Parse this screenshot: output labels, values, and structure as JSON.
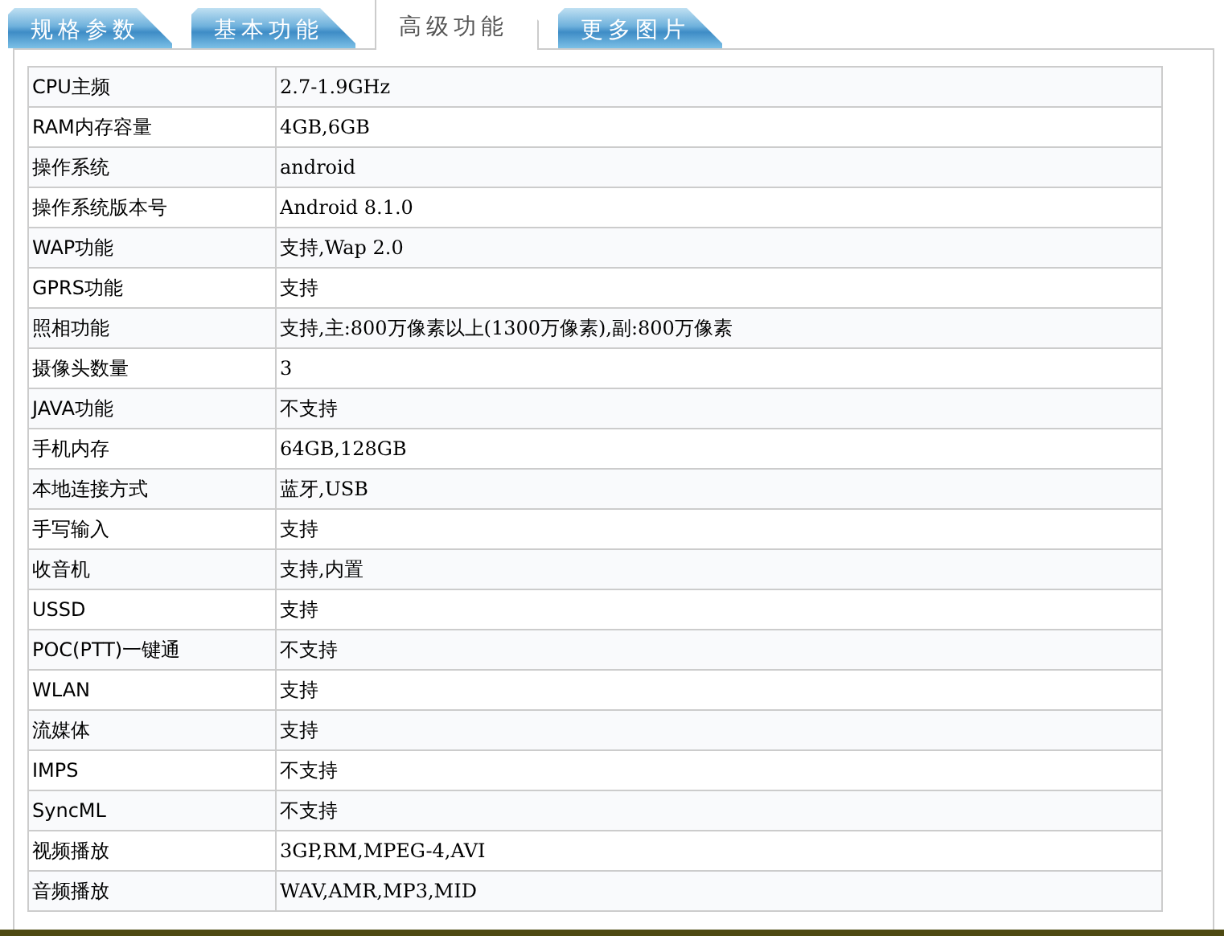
{
  "tabs": [
    {
      "label": "规格参数",
      "selected": false
    },
    {
      "label": "基本功能",
      "selected": false
    },
    {
      "label": "高级功能",
      "selected": true
    },
    {
      "label": "更多图片",
      "selected": false
    }
  ],
  "specs": [
    {
      "label": "CPU主频",
      "value": "2.7-1.9GHz"
    },
    {
      "label": "RAM内存容量",
      "value": "4GB,6GB"
    },
    {
      "label": "操作系统",
      "value": "android"
    },
    {
      "label": "操作系统版本号",
      "value": "Android 8.1.0"
    },
    {
      "label": "WAP功能",
      "value": "支持,Wap 2.0"
    },
    {
      "label": "GPRS功能",
      "value": "支持"
    },
    {
      "label": "照相功能",
      "value": "支持,主:800万像素以上(1300万像素),副:800万像素"
    },
    {
      "label": "摄像头数量",
      "value": "3"
    },
    {
      "label": "JAVA功能",
      "value": "不支持"
    },
    {
      "label": "手机内存",
      "value": "64GB,128GB"
    },
    {
      "label": "本地连接方式",
      "value": "蓝牙,USB"
    },
    {
      "label": "手写输入",
      "value": "支持"
    },
    {
      "label": "收音机",
      "value": "支持,内置"
    },
    {
      "label": "USSD",
      "value": "支持"
    },
    {
      "label": "POC(PTT)一键通",
      "value": "不支持"
    },
    {
      "label": "WLAN",
      "value": "支持"
    },
    {
      "label": "流媒体",
      "value": "支持"
    },
    {
      "label": "IMPS",
      "value": "不支持"
    },
    {
      "label": "SyncML",
      "value": "不支持"
    },
    {
      "label": "视频播放",
      "value": "3GP,RM,MPEG-4,AVI"
    },
    {
      "label": "音频播放",
      "value": "WAV,AMR,MP3,MID"
    }
  ]
}
